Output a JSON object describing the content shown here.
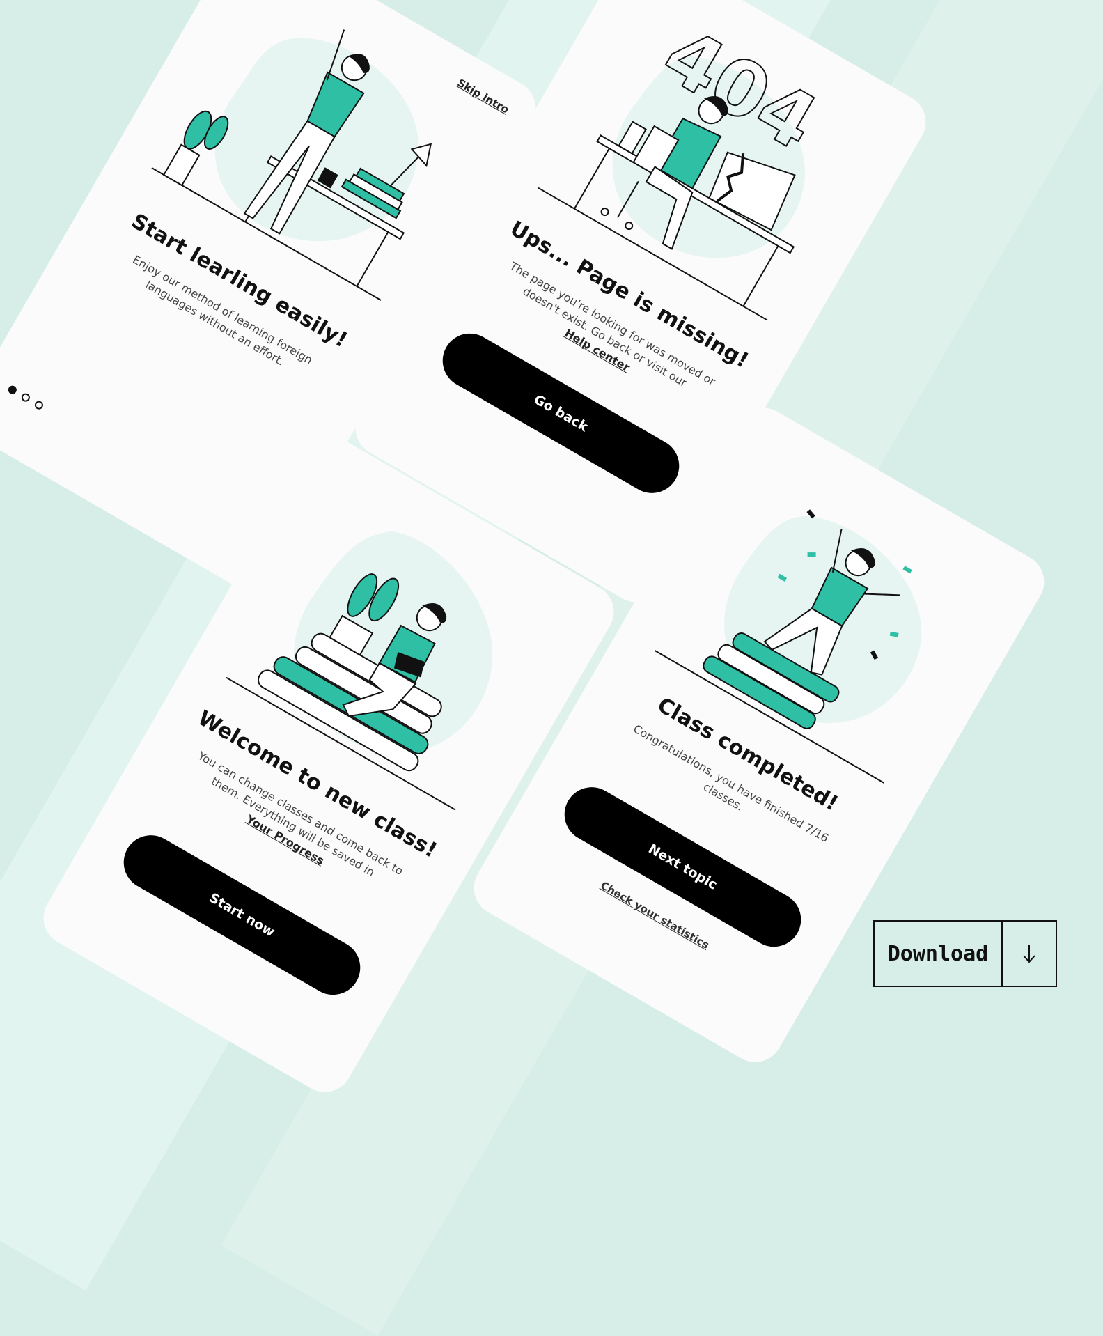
{
  "colors": {
    "accent": "#2ebfa5",
    "background": "#d6eee7",
    "card": "#fbfbfb",
    "button": "#000000"
  },
  "cards": {
    "intro": {
      "skip_label": "Skip intro",
      "title": "Start learling easily!",
      "body": "Enjoy our method of learning foreign languages without an effort.",
      "pager": {
        "count": 3,
        "active_index": 0
      }
    },
    "missing": {
      "title": "Ups... Page is missing!",
      "body": "The page you're looking for was moved or doesn't exist. Go back or visit our",
      "link": "Help center",
      "illustration_text": "404",
      "button": "Go back"
    },
    "welcome": {
      "title": "Welcome to new class!",
      "body": "You can change classes and come back to them. Everything will be saved in",
      "link": "Your Progress",
      "button": "Start now"
    },
    "completed": {
      "title": "Class completed!",
      "body": "Congratulations, you have finished 7/16 classes.",
      "button": "Next topic",
      "link": "Check your statistics"
    }
  },
  "download": {
    "label": "Download",
    "icon": "arrow-down-icon"
  }
}
